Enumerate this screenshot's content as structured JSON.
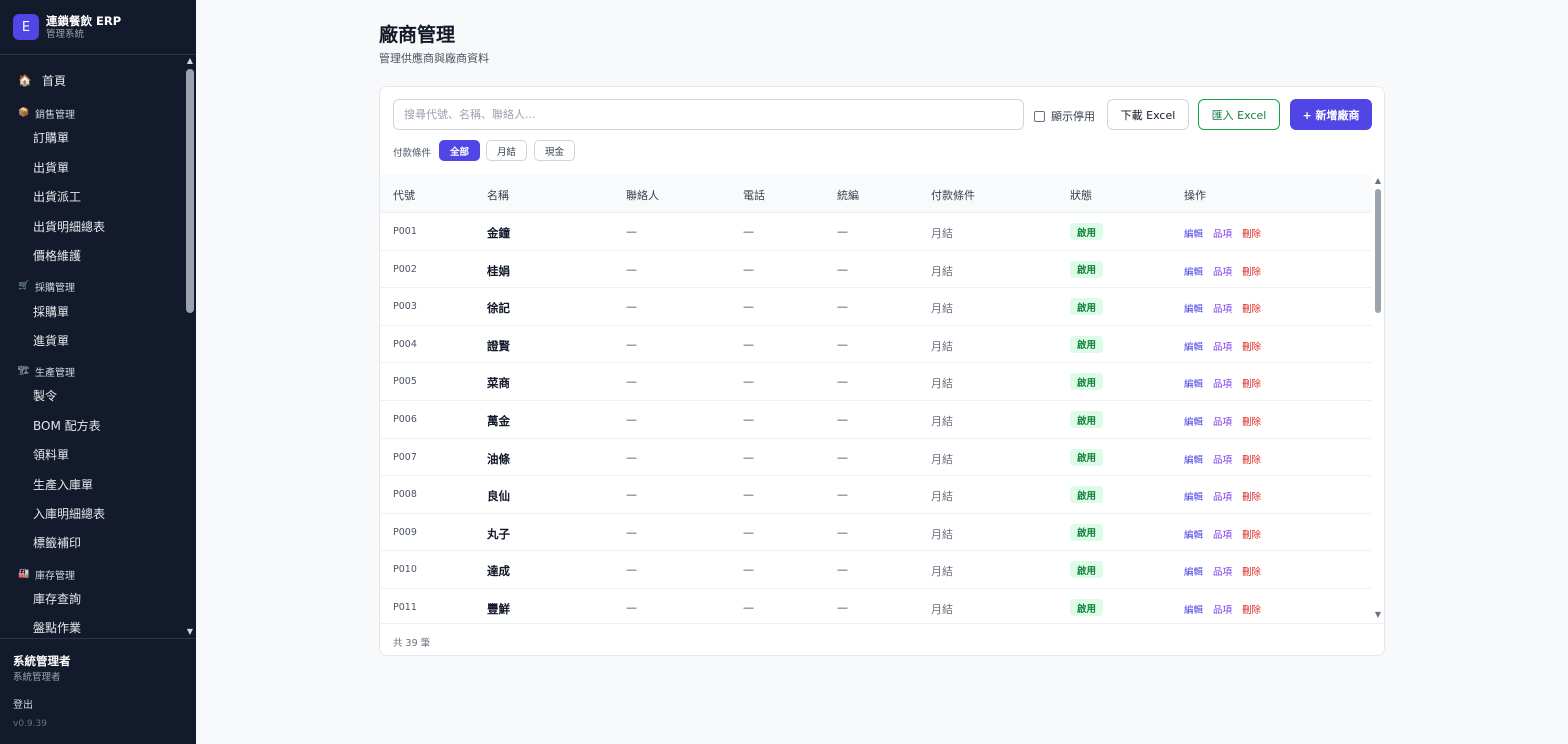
{
  "brand": {
    "logo": "E",
    "title": "連鎖餐飲 ERP",
    "subtitle": "管理系統"
  },
  "sidebar": {
    "home": {
      "icon": "🏠",
      "label": "首頁"
    },
    "groups": [
      {
        "icon": "📦",
        "label": "銷售管理",
        "items": [
          "訂購單",
          "出貨單",
          "出貨派工",
          "出貨明細總表",
          "價格維護"
        ]
      },
      {
        "icon": "🛒",
        "label": "採購管理",
        "items": [
          "採購單",
          "進貨單"
        ]
      },
      {
        "icon": "🏗",
        "label": "生產管理",
        "items": [
          "製令",
          "BOM 配方表",
          "領料單",
          "生產入庫單",
          "入庫明細總表",
          "標籤補印"
        ]
      },
      {
        "icon": "🏭",
        "label": "庫存管理",
        "items": [
          "庫存查詢",
          "盤點作業"
        ]
      }
    ]
  },
  "user": {
    "name": "系統管理者",
    "role": "系統管理者",
    "logout": "登出",
    "version": "v0.9.39"
  },
  "page": {
    "title": "廠商管理",
    "subtitle": "管理供應商與廠商資料"
  },
  "toolbar": {
    "search_placeholder": "搜尋代號、名稱、聯絡人...",
    "show_disabled": "顯示停用",
    "download": "下載 Excel",
    "import": "匯入 Excel",
    "add": "+ 新增廠商"
  },
  "filter": {
    "label": "付款條件",
    "chips": [
      "全部",
      "月結",
      "現金"
    ],
    "selected": "全部"
  },
  "table": {
    "columns": [
      "代號",
      "名稱",
      "聯絡人",
      "電話",
      "統編",
      "付款條件",
      "狀態",
      "操作"
    ],
    "actions": [
      "編輯",
      "品項",
      "刪除"
    ],
    "rows": [
      {
        "code": "P001",
        "name": "金鐘",
        "contact": "—",
        "phone": "—",
        "tax_id": "—",
        "payment": "月結",
        "status": "啟用"
      },
      {
        "code": "P002",
        "name": "桂娟",
        "contact": "—",
        "phone": "—",
        "tax_id": "—",
        "payment": "月結",
        "status": "啟用"
      },
      {
        "code": "P003",
        "name": "徐記",
        "contact": "—",
        "phone": "—",
        "tax_id": "—",
        "payment": "月結",
        "status": "啟用"
      },
      {
        "code": "P004",
        "name": "證賢",
        "contact": "—",
        "phone": "—",
        "tax_id": "—",
        "payment": "月結",
        "status": "啟用"
      },
      {
        "code": "P005",
        "name": "菜商",
        "contact": "—",
        "phone": "—",
        "tax_id": "—",
        "payment": "月結",
        "status": "啟用"
      },
      {
        "code": "P006",
        "name": "萬金",
        "contact": "—",
        "phone": "—",
        "tax_id": "—",
        "payment": "月結",
        "status": "啟用"
      },
      {
        "code": "P007",
        "name": "油條",
        "contact": "—",
        "phone": "—",
        "tax_id": "—",
        "payment": "月結",
        "status": "啟用"
      },
      {
        "code": "P008",
        "name": "良仙",
        "contact": "—",
        "phone": "—",
        "tax_id": "—",
        "payment": "月結",
        "status": "啟用"
      },
      {
        "code": "P009",
        "name": "丸子",
        "contact": "—",
        "phone": "—",
        "tax_id": "—",
        "payment": "月結",
        "status": "啟用"
      },
      {
        "code": "P010",
        "name": "達成",
        "contact": "—",
        "phone": "—",
        "tax_id": "—",
        "payment": "月結",
        "status": "啟用"
      },
      {
        "code": "P011",
        "name": "豐鮮",
        "contact": "—",
        "phone": "—",
        "tax_id": "—",
        "payment": "月結",
        "status": "啟用"
      }
    ],
    "total": "共 39 筆"
  },
  "colors": {
    "sidebar_bg": "#131a2b",
    "accent": "#4f46e5",
    "success": "#15803d",
    "danger": "#dc2626"
  }
}
